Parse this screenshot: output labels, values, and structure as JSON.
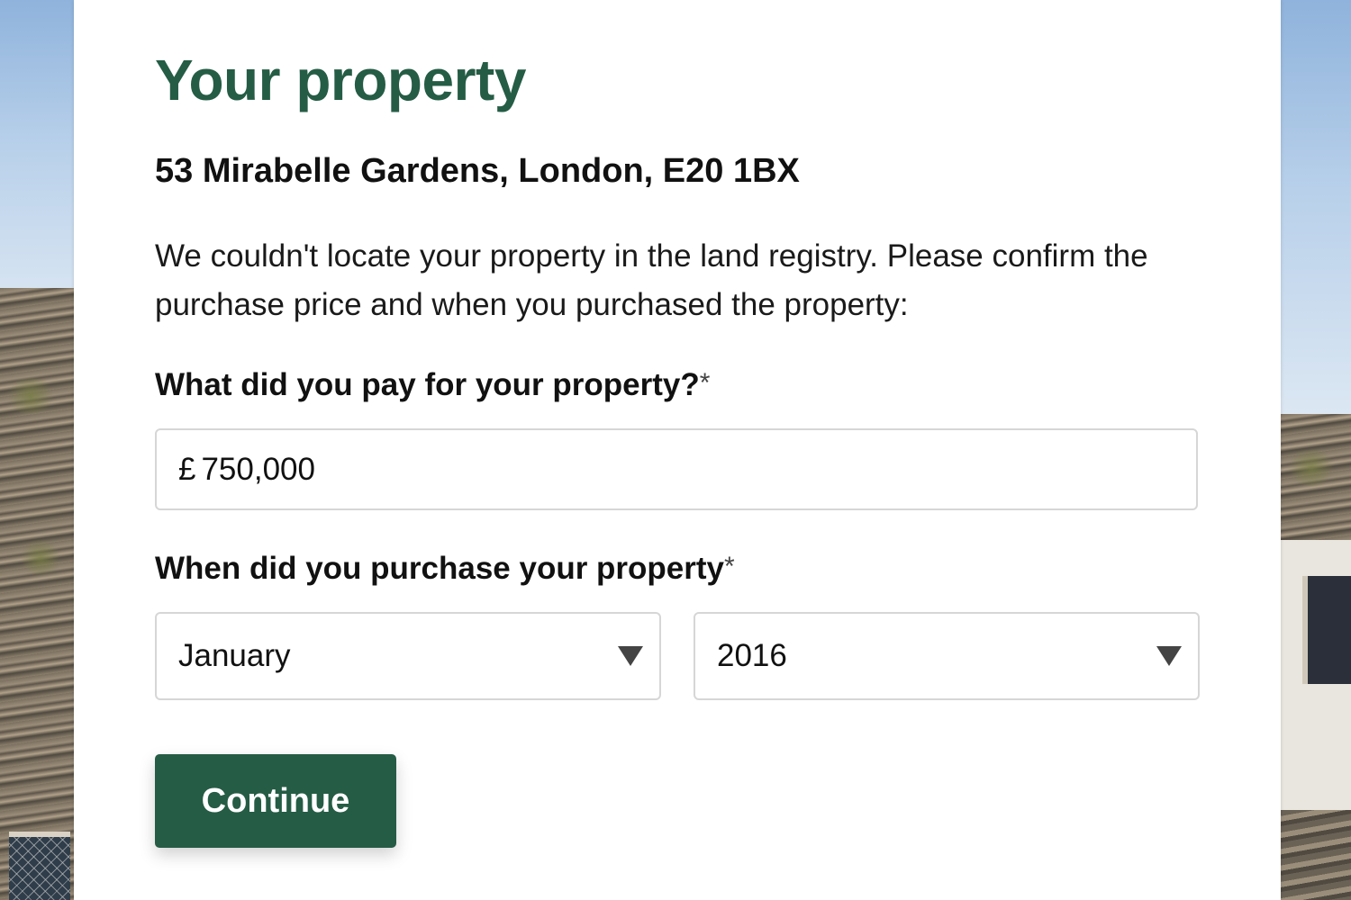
{
  "form": {
    "title": "Your property",
    "address": "53 Mirabelle Gardens, London, E20 1BX",
    "intro": "We couldn't locate your property in the land registry. Please confirm the purchase price and when you purchased the property:",
    "price": {
      "label": "What did you pay for your property?",
      "required_marker": "*",
      "currency_symbol": "£",
      "value": "750,000"
    },
    "purchase_date": {
      "label": "When did you purchase your property",
      "required_marker": "*",
      "month": "January",
      "year": "2016"
    },
    "continue_label": "Continue"
  },
  "colors": {
    "accent": "#255c45",
    "text": "#111111",
    "border": "#d6d6d6"
  }
}
